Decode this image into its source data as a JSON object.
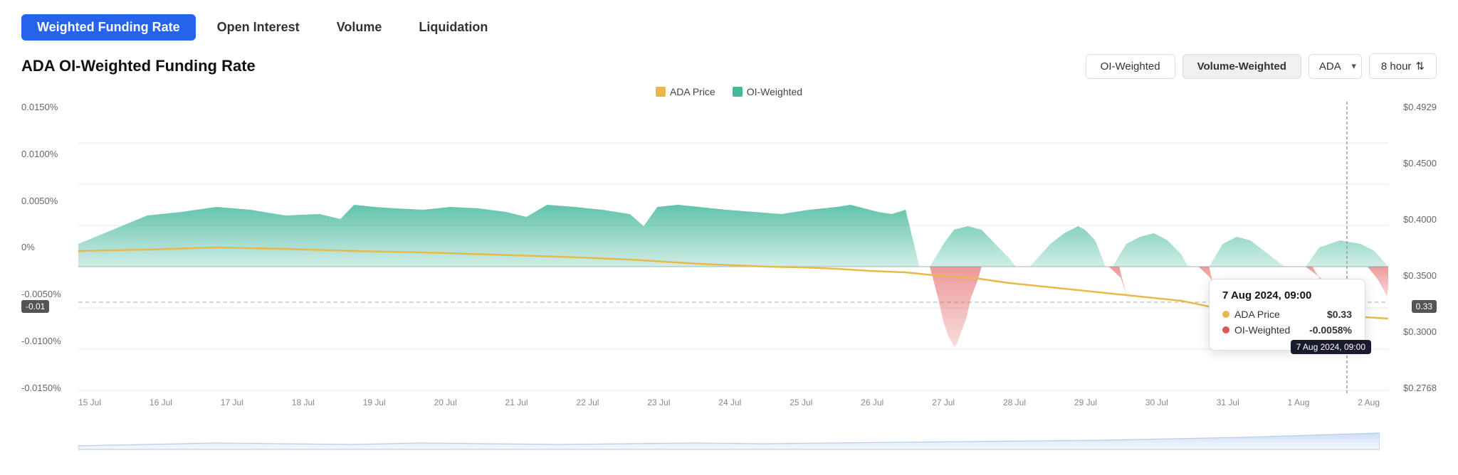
{
  "tabs": [
    {
      "label": "Weighted Funding Rate",
      "active": true
    },
    {
      "label": "Open Interest",
      "active": false
    },
    {
      "label": "Volume",
      "active": false
    },
    {
      "label": "Liquidation",
      "active": false
    }
  ],
  "chart": {
    "title": "ADA OI-Weighted Funding Rate",
    "controls": {
      "oi_weighted_label": "OI-Weighted",
      "volume_weighted_label": "Volume-Weighted",
      "asset_label": "ADA",
      "timeframe_label": "8 hour"
    },
    "legend": [
      {
        "label": "ADA Price",
        "color": "#e8b84b"
      },
      {
        "label": "OI-Weighted",
        "color": "#45b89c"
      }
    ],
    "y_axis_left": [
      "0.0150%",
      "0.0100%",
      "0.0050%",
      "0%",
      "-0.0050%",
      "-0.0100%",
      "-0.0150%"
    ],
    "y_axis_right": [
      "$0.4929",
      "$0.4500",
      "$0.4000",
      "$0.3500",
      "$0.3000",
      "$0.2768"
    ],
    "x_axis": [
      "15 Jul",
      "16 Jul",
      "17 Jul",
      "18 Jul",
      "19 Jul",
      "20 Jul",
      "21 Jul",
      "22 Jul",
      "23 Jul",
      "24 Jul",
      "25 Jul",
      "26 Jul",
      "27 Jul",
      "28 Jul",
      "29 Jul",
      "30 Jul",
      "31 Jul",
      "1 Aug",
      "2 Aug"
    ],
    "cursor": {
      "left_label": "-0.01",
      "right_label": "0.33",
      "y_pct": 68
    },
    "tooltip": {
      "title": "7 Aug 2024, 09:00",
      "rows": [
        {
          "label": "ADA Price",
          "value": "$0.33",
          "color": "#e8b84b"
        },
        {
          "label": "OI-Weighted",
          "value": "-0.0058%",
          "color": "#e05555"
        }
      ]
    },
    "time_pin": "2024, 09:00"
  }
}
